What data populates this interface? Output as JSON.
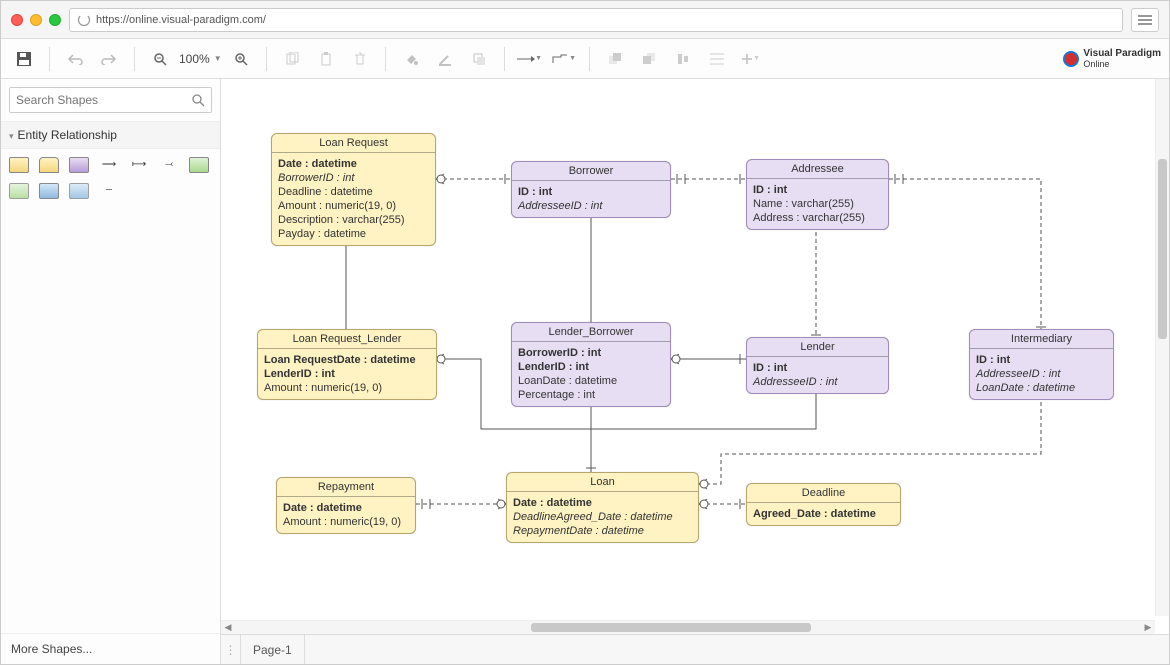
{
  "address_bar": {
    "url": "https://online.visual-paradigm.com/"
  },
  "toolbar": {
    "zoom_label": "100%"
  },
  "logo": {
    "line1": "Visual Paradigm",
    "line2": "Online"
  },
  "sidebar": {
    "search_placeholder": "Search Shapes",
    "category_label": "Entity Relationship",
    "more_shapes_label": "More Shapes..."
  },
  "tabs": {
    "page1_label": "Page-1"
  },
  "entities": {
    "loan_request": {
      "title": "Loan Request",
      "attrs": [
        {
          "text": "Date : datetime",
          "pk": true
        },
        {
          "text": "BorrowerID : int",
          "fk": true
        },
        {
          "text": "Deadline : datetime"
        },
        {
          "text": "Amount : numeric(19, 0)"
        },
        {
          "text": "Description : varchar(255)"
        },
        {
          "text": "Payday : datetime"
        }
      ]
    },
    "borrower": {
      "title": "Borrower",
      "attrs": [
        {
          "text": "ID : int",
          "pk": true
        },
        {
          "text": "AddresseeID : int",
          "fk": true
        }
      ]
    },
    "addressee": {
      "title": "Addressee",
      "attrs": [
        {
          "text": "ID : int",
          "pk": true
        },
        {
          "text": "Name : varchar(255)"
        },
        {
          "text": "Address : varchar(255)"
        }
      ]
    },
    "loan_request_lender": {
      "title": "Loan Request_Lender",
      "attrs": [
        {
          "text": "Loan RequestDate : datetime",
          "pk": true
        },
        {
          "text": "LenderID : int",
          "pk": true
        },
        {
          "text": "Amount : numeric(19, 0)"
        }
      ]
    },
    "lender_borrower": {
      "title": "Lender_Borrower",
      "attrs": [
        {
          "text": "BorrowerID : int",
          "pk": true
        },
        {
          "text": "LenderID : int",
          "pk": true
        },
        {
          "text": "LoanDate : datetime"
        },
        {
          "text": "Percentage : int"
        }
      ]
    },
    "lender": {
      "title": "Lender",
      "attrs": [
        {
          "text": "ID : int",
          "pk": true
        },
        {
          "text": "AddresseeID : int",
          "fk": true
        }
      ]
    },
    "intermediary": {
      "title": "Intermediary",
      "attrs": [
        {
          "text": "ID : int",
          "pk": true
        },
        {
          "text": "AddresseeID : int",
          "fk": true
        },
        {
          "text": "LoanDate : datetime",
          "fk": true
        }
      ]
    },
    "repayment": {
      "title": "Repayment",
      "attrs": [
        {
          "text": "Date : datetime",
          "pk": true
        },
        {
          "text": "Amount : numeric(19, 0)"
        }
      ]
    },
    "loan": {
      "title": "Loan",
      "attrs": [
        {
          "text": "Date : datetime",
          "pk": true
        },
        {
          "text": "DeadlineAgreed_Date : datetime",
          "fk": true
        },
        {
          "text": "RepaymentDate : datetime",
          "fk": true
        }
      ]
    },
    "deadline": {
      "title": "Deadline",
      "attrs": [
        {
          "text": "Agreed_Date : datetime",
          "pk": true
        }
      ]
    }
  }
}
